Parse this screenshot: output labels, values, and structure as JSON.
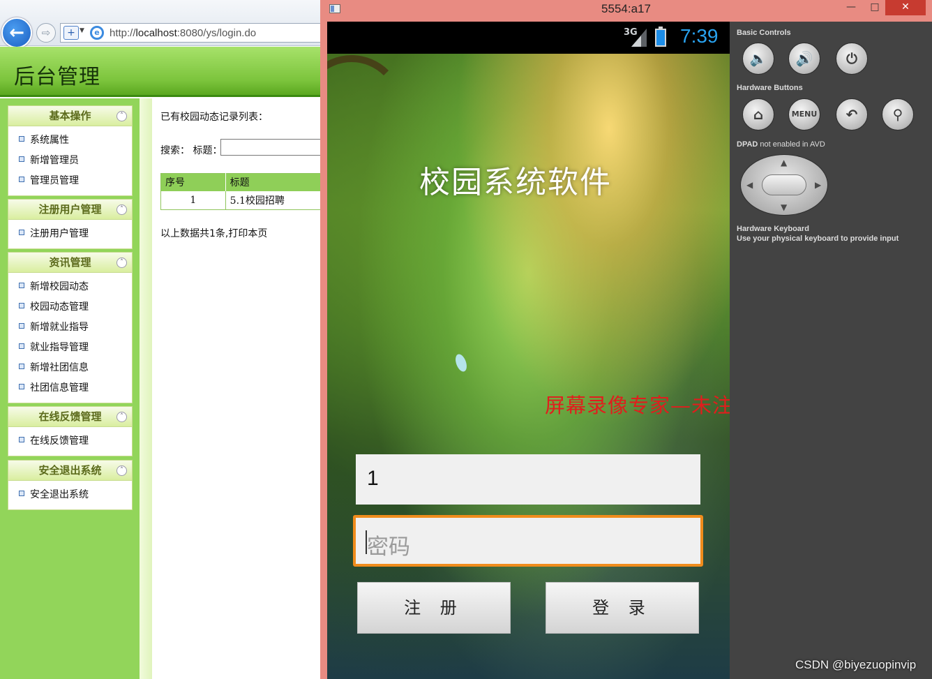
{
  "browser": {
    "url_prefix": "http://",
    "url_host": "localhost",
    "url_rest": ":8080/ys/login.do",
    "icons": [
      "back-arrow-icon",
      "forward-arrow-icon",
      "security-shield-icon",
      "ie-logo-icon"
    ]
  },
  "admin": {
    "title": "后台管理",
    "menu": [
      {
        "head": "基本操作",
        "items": [
          "系统属性",
          "新增管理员",
          "管理员管理"
        ]
      },
      {
        "head": "注册用户管理",
        "items": [
          "注册用户管理"
        ]
      },
      {
        "head": "资讯管理",
        "items": [
          "新增校园动态",
          "校园动态管理",
          "新增就业指导",
          "就业指导管理",
          "新增社团信息",
          "社团信息管理"
        ]
      },
      {
        "head": "在线反馈管理",
        "items": [
          "在线反馈管理"
        ]
      },
      {
        "head": "安全退出系统",
        "items": [
          "安全退出系统"
        ]
      }
    ],
    "content": {
      "heading": "已有校园动态记录列表：",
      "search_label": "搜索：",
      "search_title_label": "标题：",
      "search_value": "",
      "table": {
        "headers": [
          "序号",
          "标题"
        ],
        "rows": [
          [
            "1",
            "5.1校园招聘"
          ]
        ]
      },
      "summary": "以上数据共1条,打印本页"
    }
  },
  "emulator": {
    "window_title": "5554:a17",
    "window_buttons": {
      "minimize": "—",
      "maximize": "□",
      "close": "✕"
    },
    "status": {
      "network": "3G",
      "time": "7:39"
    },
    "app_title": "校园系统软件",
    "watermark": "屏幕录像专家—未注册",
    "username_value": "1",
    "password_placeholder": "密码",
    "register_label": "注 册",
    "login_label": "登 录",
    "controls": {
      "basic_label": "Basic Controls",
      "hardware_label": "Hardware Buttons",
      "dpad_label": "DPAD",
      "dpad_sub": "not enabled in AVD",
      "keyboard_label": "Hardware Keyboard",
      "keyboard_sub": "Use your physical keyboard to provide input",
      "menu_text": "MENU"
    }
  },
  "footer_watermark": "CSDN @biyezuopinvip"
}
